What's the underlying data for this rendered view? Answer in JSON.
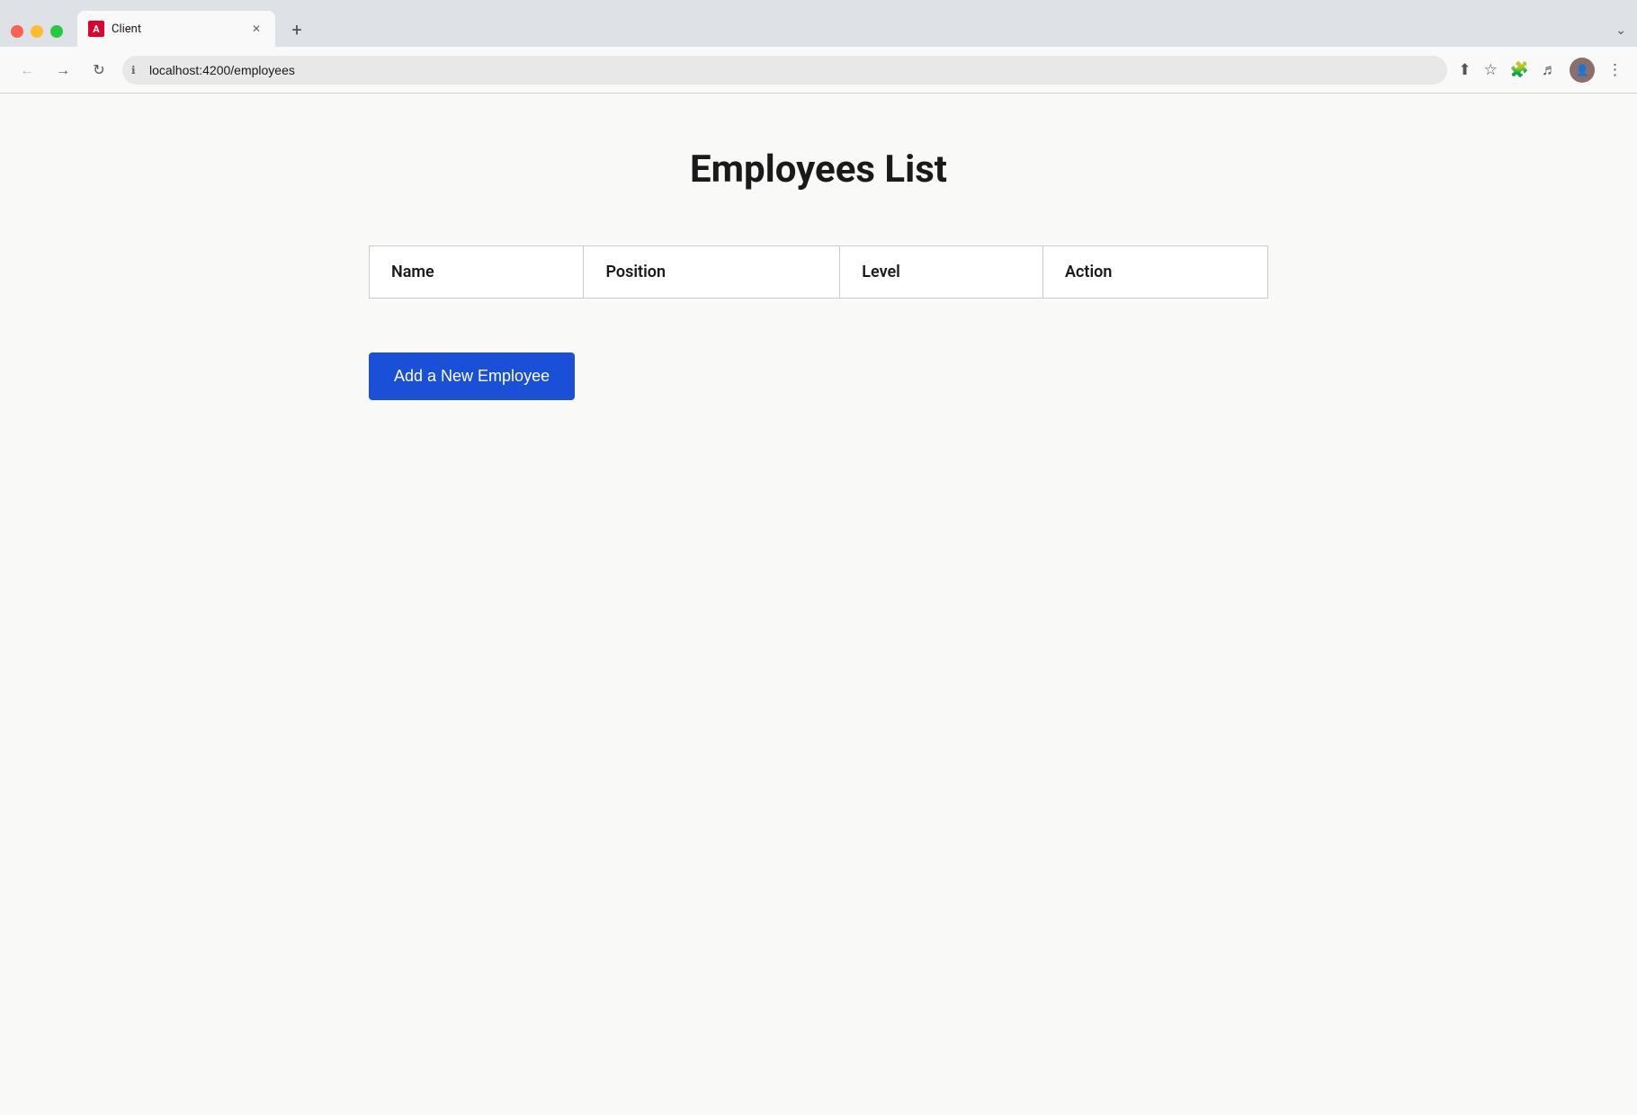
{
  "browser": {
    "tab_label": "Client",
    "tab_favicon_text": "A",
    "url": "localhost:4200/employees",
    "new_tab_symbol": "+",
    "chevron": "⌄"
  },
  "nav": {
    "back_symbol": "←",
    "forward_symbol": "→",
    "refresh_symbol": "↻",
    "info_symbol": "ℹ",
    "share_symbol": "↑",
    "bookmark_symbol": "☆",
    "extensions_symbol": "🧩",
    "media_symbol": "♬",
    "more_symbol": "⋮"
  },
  "page": {
    "title": "Employees List",
    "table": {
      "columns": [
        "Name",
        "Position",
        "Level",
        "Action"
      ],
      "rows": []
    },
    "add_button_label": "Add a New Employee"
  }
}
